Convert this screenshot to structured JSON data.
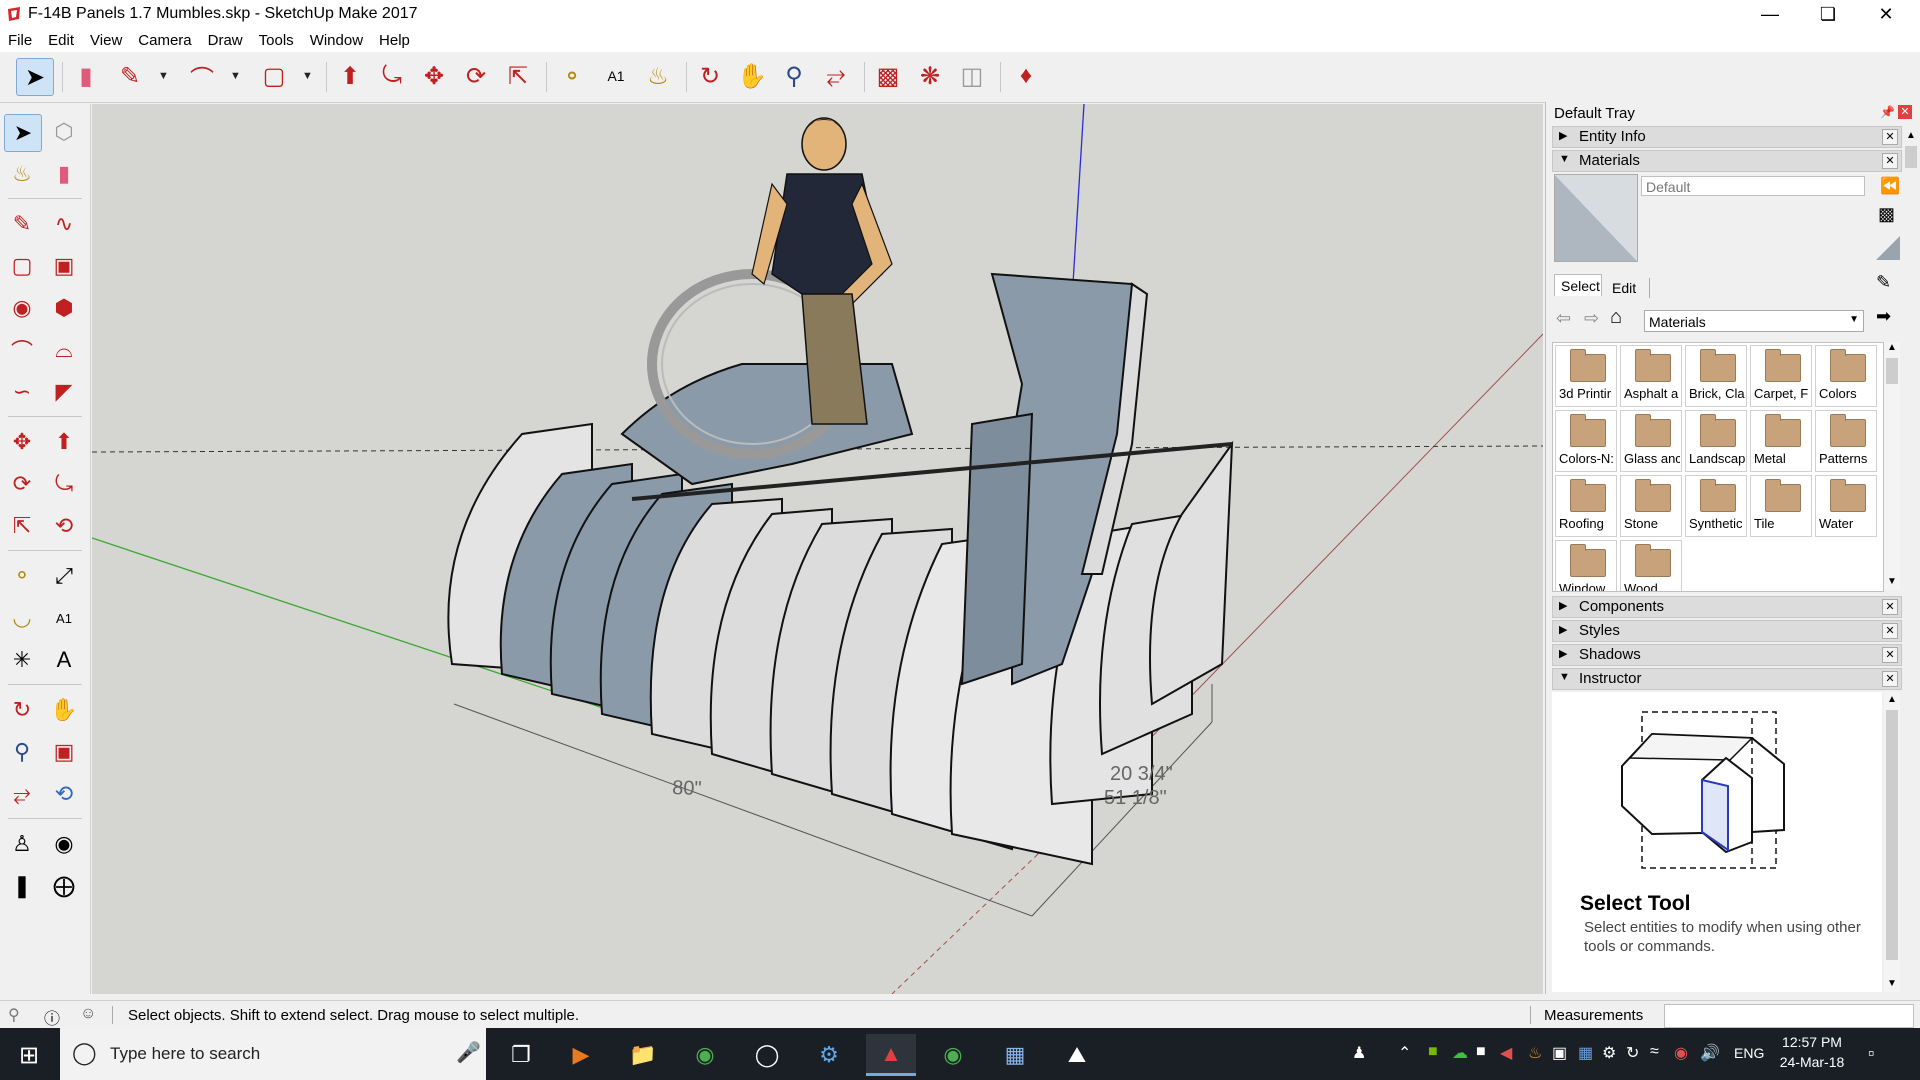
{
  "window": {
    "title": "F-14B Panels 1.7 Mumbles.skp - SketchUp Make 2017",
    "controls": [
      "minimize",
      "maximize",
      "close"
    ]
  },
  "menu": [
    "File",
    "Edit",
    "View",
    "Camera",
    "Draw",
    "Tools",
    "Window",
    "Help"
  ],
  "toolbar_icons": [
    "select-icon",
    "eraser-icon",
    "pencil-icon",
    "arc-icon",
    "rectangle-icon",
    "push-pull-icon",
    "follow-me-icon",
    "move-icon",
    "rotate-icon",
    "scale-icon",
    "tape-measure-icon",
    "text-icon",
    "paint-bucket-icon",
    "orbit-icon",
    "pan-icon",
    "zoom-icon",
    "zoom-extents-icon",
    "warehouse-icon",
    "extension-warehouse-icon",
    "layout-icon",
    "ruby-icon"
  ],
  "viewport": {
    "dimensions": [
      "80\"",
      "20 3/4\"",
      "51 1/8\""
    ]
  },
  "tray": {
    "title": "Default Tray",
    "panels": {
      "entity_info": "Entity Info",
      "materials": "Materials",
      "components": "Components",
      "styles": "Styles",
      "shadows": "Shadows",
      "instructor": "Instructor"
    },
    "materials": {
      "current_name": "Default",
      "tabs": [
        "Select",
        "Edit"
      ],
      "library": "Materials",
      "items": [
        "3d Printir",
        "Asphalt a",
        "Brick, Cla",
        "Carpet, F",
        "Colors",
        "Colors-N:",
        "Glass anc",
        "Landscap",
        "Metal",
        "Patterns",
        "Roofing",
        "Stone",
        "Synthetic",
        "Tile",
        "Water",
        "Window",
        "Wood"
      ]
    },
    "instructor": {
      "heading": "Select Tool",
      "description": "Select entities to modify when using other tools or commands."
    }
  },
  "status": {
    "message": "Select objects. Shift to extend select. Drag mouse to select multiple.",
    "measurements_label": "Measurements",
    "measurements_value": ""
  },
  "taskbar": {
    "search_placeholder": "Type here to search",
    "language": "ENG",
    "time": "12:57 PM",
    "date": "24-Mar-18"
  },
  "colors": {
    "viewport_bg": "#d5d5d2",
    "axis_green": "#3aa832",
    "axis_blue": "#2b2bd8",
    "axis_red": "#b04040",
    "panel_blue": "#8a9aa8",
    "panel_light": "#dcdcdc"
  }
}
